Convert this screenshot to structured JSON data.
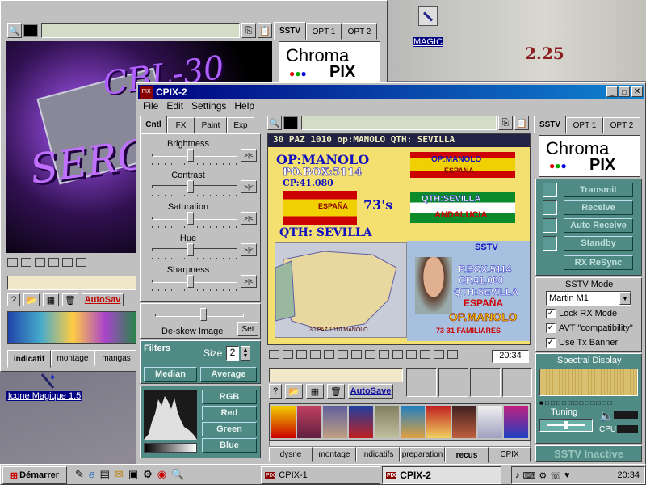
{
  "colors": {
    "desktop": "#7a7a88",
    "titlebar_active": "#000080",
    "titlebar_inactive": "#808080",
    "panel_teal": "#4f8a85",
    "autosave_red": "#c00000"
  },
  "desktop": {
    "icons": [
      {
        "label": "MAGIC",
        "icon": "magic-wand-icon"
      },
      {
        "label": "Icone Magique 1.5",
        "icon": "magic-wand-icon"
      }
    ],
    "background_text": "2.25"
  },
  "back_window": {
    "tabs": [
      "SSTV",
      "OPT 1",
      "OPT 2"
    ],
    "logo_chroma": "Chroma",
    "logo_pix": "PIX",
    "image_text": {
      "line1": "CBL-30",
      "line2": "SERG"
    },
    "autosave_label": "AutoSav",
    "bottom_tabs": [
      "indicatif",
      "montage",
      "mangas"
    ]
  },
  "cpix2": {
    "title": "CPIX-2",
    "menu": [
      "File",
      "Edit",
      "Settings",
      "Help"
    ],
    "left_tabs": [
      "Cntl",
      "FX",
      "Paint",
      "Exp"
    ],
    "sliders": [
      {
        "label": "Brightness",
        "value": 0.45
      },
      {
        "label": "Contrast",
        "value": 0.45
      },
      {
        "label": "Saturation",
        "value": 0.45
      },
      {
        "label": "Hue",
        "value": 0.45
      },
      {
        "label": "Sharpness",
        "value": 0.45
      }
    ],
    "reset_glyph": ">|<",
    "deskew": {
      "label": "De-skew Image",
      "set_label": "Set",
      "value": 0.55
    },
    "filters": {
      "title": "Filters",
      "size_label": "Size",
      "size_value": "2",
      "median_label": "Median",
      "average_label": "Average"
    },
    "color_buttons": [
      "RGB",
      "Red",
      "Green",
      "Blue"
    ],
    "image": {
      "header": "30 PAZ 1010 op:MANOLO QTH: SEVILLA",
      "op": "OP:MANOLO",
      "pobox": "PO.BOX:5114",
      "cp": "CP:41.080",
      "espana": "ESPAÑA",
      "seventy3": "73's",
      "qth": "QTH: SEVILLA",
      "flag_op": "OP:MANOLO",
      "flag_espana": "ESPAÑA",
      "flag_qth": "QTH:SEVILLA",
      "andalucia": "ANDALUCIA",
      "sstv": "SSTV",
      "box2": "P.BOX.5114",
      "cp2": "CP.41.080",
      "qth2": "QTH:SEVILLA",
      "espana2": "ESPAÑA",
      "opm": "OP.MANOLO",
      "familiares": "73-31 FAMILIARES",
      "map_caption": "30 PAZ 1010 MANOLO"
    },
    "time": "20:34",
    "autosave_label": "AutoSave",
    "bottom_tabs": [
      "dysne",
      "montage",
      "indicatifs",
      "preparation",
      "recus",
      "CPIX"
    ],
    "right_tabs": [
      "SSTV",
      "OPT 1",
      "OPT 2"
    ],
    "logo_chroma": "Chroma",
    "logo_pix": "PIX",
    "actions": [
      "Transmit",
      "Receive",
      "Auto Receive",
      "Standby",
      "RX ReSync"
    ],
    "sstv_mode_label": "SSTV Mode",
    "sstv_mode_value": "Martin M1",
    "checkboxes": [
      {
        "label": "Lock RX Mode",
        "checked": true
      },
      {
        "label": "AVT \"compatibility\"",
        "checked": true
      },
      {
        "label": "Use Tx Banner",
        "checked": true
      }
    ],
    "spectral_label": "Spectral Display",
    "tuning_label": "Tuning",
    "cpu_label": "CPU",
    "status": "SSTV Inactive"
  },
  "taskbar": {
    "start_label": "Démarrer",
    "tasks": [
      "CPIX-1",
      "CPIX-2"
    ],
    "clock": "20:34"
  }
}
